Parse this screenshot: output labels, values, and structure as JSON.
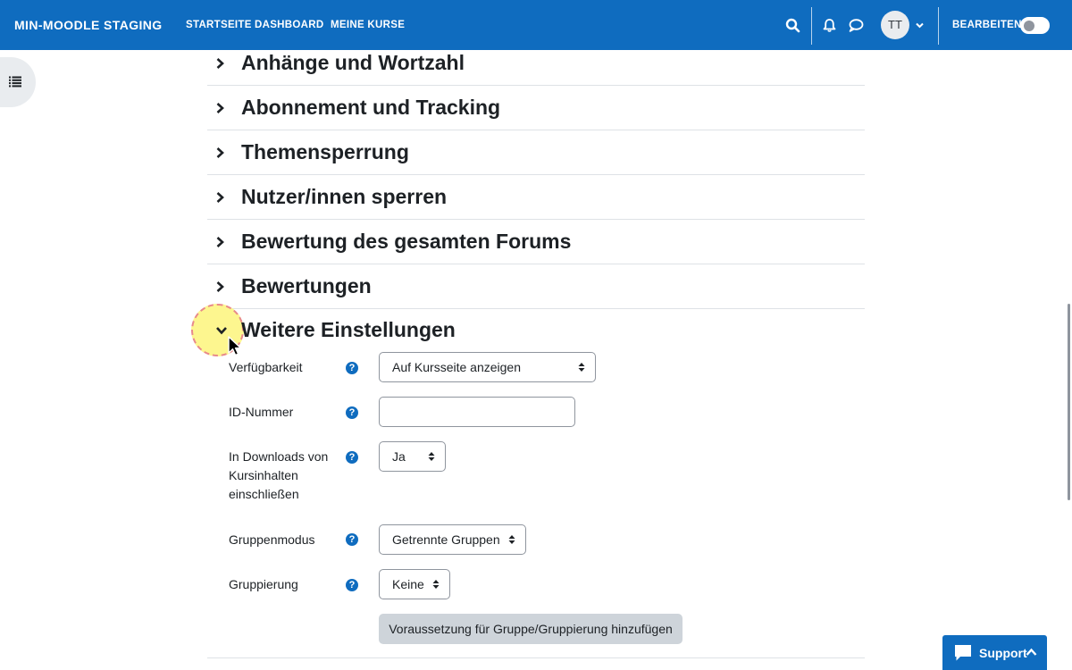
{
  "navbar": {
    "brand": "MIN-MOODLE STAGING",
    "links": [
      "STARTSEITE",
      "DASHBOARD",
      "MEINE KURSE"
    ],
    "avatar_initials": "TT",
    "edit_mode_label": "BEARBEITEN",
    "edit_mode_on": false,
    "colors": {
      "bar": "#0f6cbf",
      "text": "#ffffff"
    }
  },
  "sections": [
    {
      "title": "Anhänge und Wortzahl",
      "expanded": false
    },
    {
      "title": "Abonnement und Tracking",
      "expanded": false
    },
    {
      "title": "Themensperrung",
      "expanded": false
    },
    {
      "title": "Nutzer/innen sperren",
      "expanded": false
    },
    {
      "title": "Bewertung des gesamten Forums",
      "expanded": false
    },
    {
      "title": "Bewertungen",
      "expanded": false
    },
    {
      "title": "Weitere Einstellungen",
      "expanded": true
    }
  ],
  "form": {
    "availability": {
      "label": "Verfügbarkeit",
      "value": "Auf Kursseite anzeigen"
    },
    "id_number": {
      "label": "ID-Nummer",
      "value": ""
    },
    "downloads": {
      "label": "In Downloads von Kursinhalten einschließen",
      "value": "Ja"
    },
    "group_mode": {
      "label": "Gruppenmodus",
      "value": "Getrennte Gruppen"
    },
    "grouping": {
      "label": "Gruppierung",
      "value": "Keine"
    },
    "add_restriction_button": "Voraussetzung für Gruppe/Gruppierung hinzufügen",
    "help_glyph": "?"
  },
  "support": {
    "label": "Support"
  },
  "icons": {
    "search": "search-icon",
    "notifications": "bell-icon",
    "messages": "chat-bubble-icon",
    "user_menu": "chevron-down-icon",
    "drawer": "list-icon",
    "section_collapsed": "chevron-right-icon",
    "section_expanded": "chevron-down-icon",
    "help": "help-circle-icon",
    "support": "chat-icon"
  }
}
